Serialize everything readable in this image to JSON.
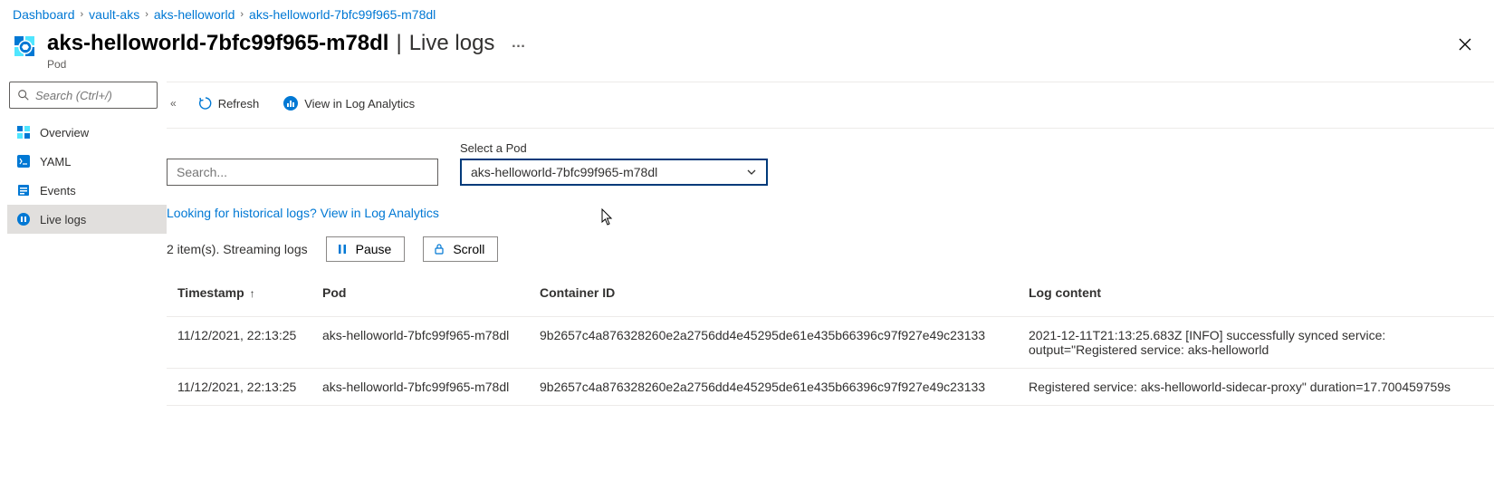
{
  "breadcrumb": [
    {
      "label": "Dashboard"
    },
    {
      "label": "vault-aks"
    },
    {
      "label": "aks-helloworld"
    },
    {
      "label": "aks-helloworld-7bfc99f965-m78dl"
    }
  ],
  "header": {
    "name": "aks-helloworld-7bfc99f965-m78dl",
    "section": "Live logs",
    "subtitle": "Pod",
    "more": "…",
    "close": "✕"
  },
  "search": {
    "placeholder": "Search (Ctrl+/)"
  },
  "sidebar": {
    "items": [
      {
        "icon": "overview-icon",
        "label": "Overview"
      },
      {
        "icon": "yaml-icon",
        "label": "YAML"
      },
      {
        "icon": "events-icon",
        "label": "Events"
      },
      {
        "icon": "livelogs-icon",
        "label": "Live logs"
      }
    ]
  },
  "toolbar": {
    "collapse": "«",
    "refresh": "Refresh",
    "view_log_analytics": "View in Log Analytics"
  },
  "filter": {
    "search_placeholder": "Search...",
    "pod_label": "Select a Pod",
    "pod_value": "aks-helloworld-7bfc99f965-m78dl"
  },
  "historical_link": "Looking for historical logs? View in Log Analytics",
  "status": {
    "text": "2 item(s). Streaming logs",
    "pause": "Pause",
    "scroll": "Scroll"
  },
  "table": {
    "headers": {
      "timestamp": "Timestamp",
      "pod": "Pod",
      "container_id": "Container ID",
      "log_content": "Log content"
    },
    "sort_arrow": "↑",
    "rows": [
      {
        "timestamp": "11/12/2021, 22:13:25",
        "pod": "aks-helloworld-7bfc99f965-m78dl",
        "container_id": "9b2657c4a876328260e2a2756dd4e45295de61e435b66396c97f927e49c23133",
        "log_content": "2021-12-11T21:13:25.683Z [INFO] successfully synced service: output=\"Registered service: aks-helloworld"
      },
      {
        "timestamp": "11/12/2021, 22:13:25",
        "pod": "aks-helloworld-7bfc99f965-m78dl",
        "container_id": "9b2657c4a876328260e2a2756dd4e45295de61e435b66396c97f927e49c23133",
        "log_content": "Registered service: aks-helloworld-sidecar-proxy\" duration=17.700459759s"
      }
    ]
  }
}
